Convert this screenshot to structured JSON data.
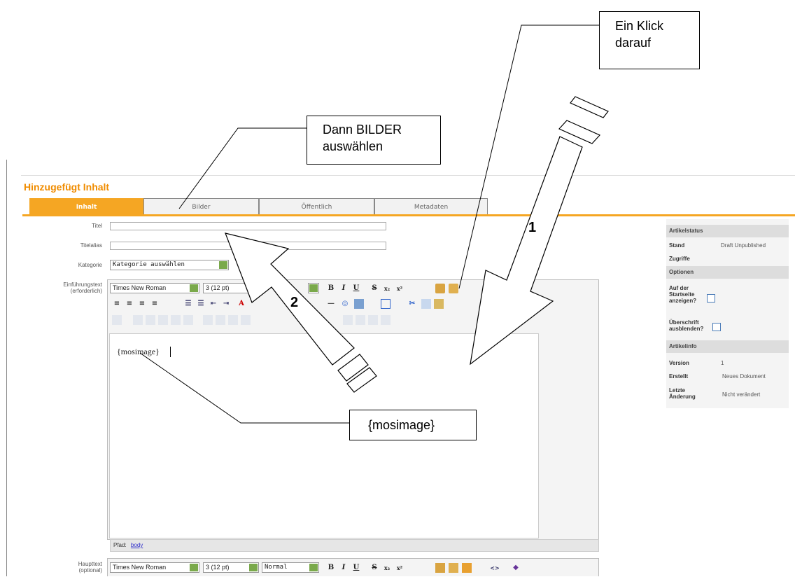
{
  "page": {
    "heading": "Hinzugefügt Inhalt"
  },
  "tabs": [
    {
      "label": "Inhalt",
      "active": true
    },
    {
      "label": "Bilder",
      "active": false
    },
    {
      "label": "Öffentlich",
      "active": false
    },
    {
      "label": "Metadaten",
      "active": false
    }
  ],
  "form": {
    "title_label": "Titel",
    "alias_label": "Titelalias",
    "category_label": "Kategorie",
    "category_value": "Kategorie auswählen",
    "intro_label_1": "Einführungstext",
    "intro_label_2": "(erforderlich)",
    "main_label_1": "Haupttext",
    "main_label_2": "(optional)"
  },
  "editor": {
    "font": "Times New Roman",
    "size": "3 (12 pt)",
    "format": "Normal",
    "content": "{mosimage}",
    "path_label": "Pfad:",
    "path_link": "body"
  },
  "sidebar": {
    "status_head": "Artikelstatus",
    "stand_label": "Stand",
    "stand_value": "Draft Unpublished",
    "zugriffe_label": "Zugriffe",
    "options_head": "Optionen",
    "frontpage_label_1": "Auf der",
    "frontpage_label_2": "Startseite",
    "frontpage_label_3": "anzeigen?",
    "hidetitle_label_1": "Überschrift",
    "hidetitle_label_2": "ausblenden?",
    "info_head": "Artikelinfo",
    "version_label": "Version",
    "version_value": "1",
    "created_label": "Erstellt",
    "created_value": "Neues Dokument",
    "changed_label_1": "Letzte",
    "changed_label_2": "Änderung",
    "changed_value": "Nicht verändert"
  },
  "annotations": {
    "callout_click_1": "Ein Klick",
    "callout_click_2": "darauf",
    "callout_bilder_1": "Dann BILDER",
    "callout_bilder_2": "auswählen",
    "callout_mosimage": "{mosimage}",
    "step1": "1",
    "step2": "2"
  },
  "colors": {
    "accent": "#f5a623",
    "heading": "#f08c00",
    "select_arrow": "#7aa94b"
  }
}
